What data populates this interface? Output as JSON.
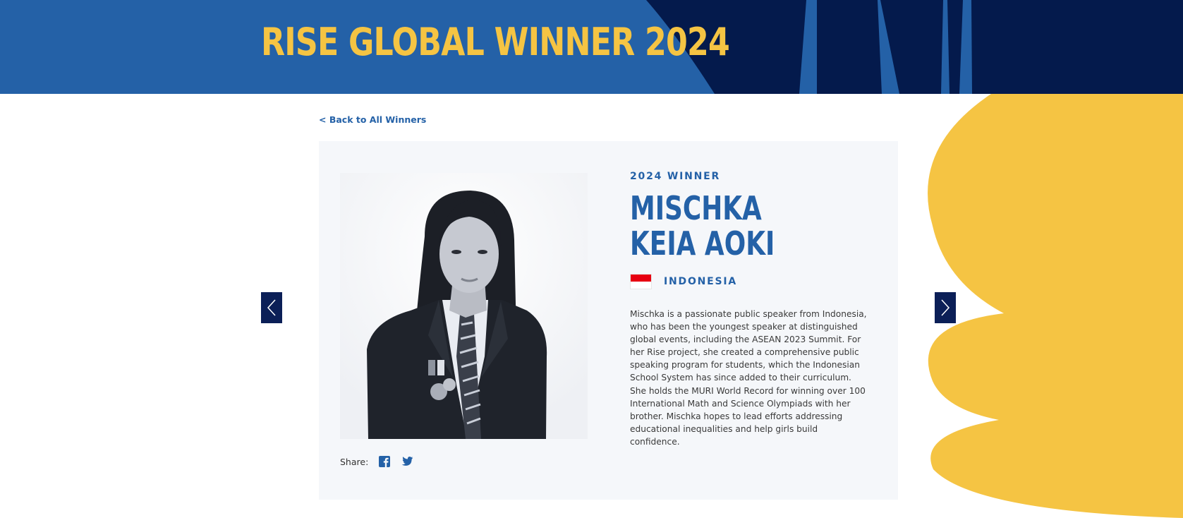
{
  "banner": {
    "title": "RISE GLOBAL WINNER 2024",
    "colors": {
      "background": "#2461a7",
      "dark": "#041a4c",
      "title": "#f5c443"
    }
  },
  "back_link": {
    "label": "< Back to All Winners"
  },
  "winner": {
    "eyebrow": "2024 WINNER",
    "name_line1": "MISCHKA",
    "name_line2": "KEIA AOKI",
    "country": "INDONESIA",
    "flag": "indonesia-flag",
    "bio": "Mischka is a passionate public speaker from Indonesia, who has been the youngest speaker at distinguished global events, including the ASEAN 2023 Summit. For her Rise project, she created a comprehensive public speaking program for students, which the Indonesian School System has since added to their curriculum. She holds the MURI World Record for winning over 100 International Math and Science Olympiads with her brother. Mischka hopes to lead efforts addressing educational inequalities and help girls build confidence."
  },
  "share": {
    "label": "Share:",
    "icons": [
      "facebook-icon",
      "twitter-icon"
    ]
  },
  "nav": {
    "prev_icon": "chevron-left-icon",
    "next_icon": "chevron-right-icon"
  },
  "accent_colors": {
    "blue": "#2461a7",
    "navy": "#0b1f57",
    "yellow": "#f5c443",
    "card": "#f5f7fa"
  }
}
